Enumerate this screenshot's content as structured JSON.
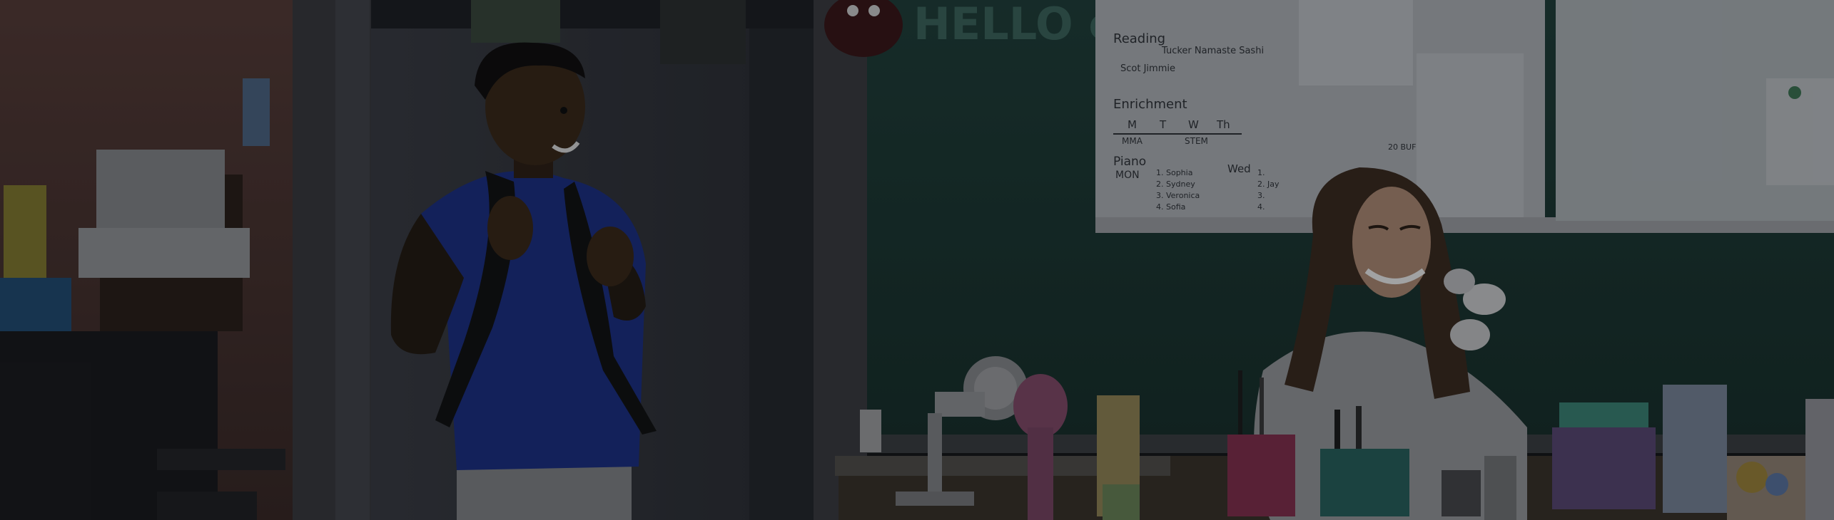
{
  "photo": {
    "alt": "Smiling student with a backpack entering a classroom while a laughing teacher sits at her desk"
  },
  "chalkboard": {
    "text": "HELLO class"
  },
  "whiteboard": {
    "reading_heading": "Reading",
    "reading_names_left": "Scot Jimmie",
    "reading_names_right": "Tucker Namaste Sashi",
    "enrichment_heading": "Enrichment",
    "days": [
      "M",
      "T",
      "W",
      "Th"
    ],
    "enrichment_row": [
      "MMA",
      "",
      "STEM",
      ""
    ],
    "piano_heading": "Piano",
    "mon_label": "MON",
    "wed_label": "Wed",
    "mon_list": [
      "1. Sophia",
      "2. Sydney",
      "3. Veronica",
      "4. Sofia"
    ],
    "wed_list": [
      "1.",
      "2. Jay",
      "3.",
      "4."
    ],
    "note": "20 BUF"
  },
  "colors": {
    "wall": "#4a3430",
    "chalkboard": "#1c3b35",
    "shirt": "#1b2f8a",
    "whiteboard": "#bfc3c7"
  }
}
